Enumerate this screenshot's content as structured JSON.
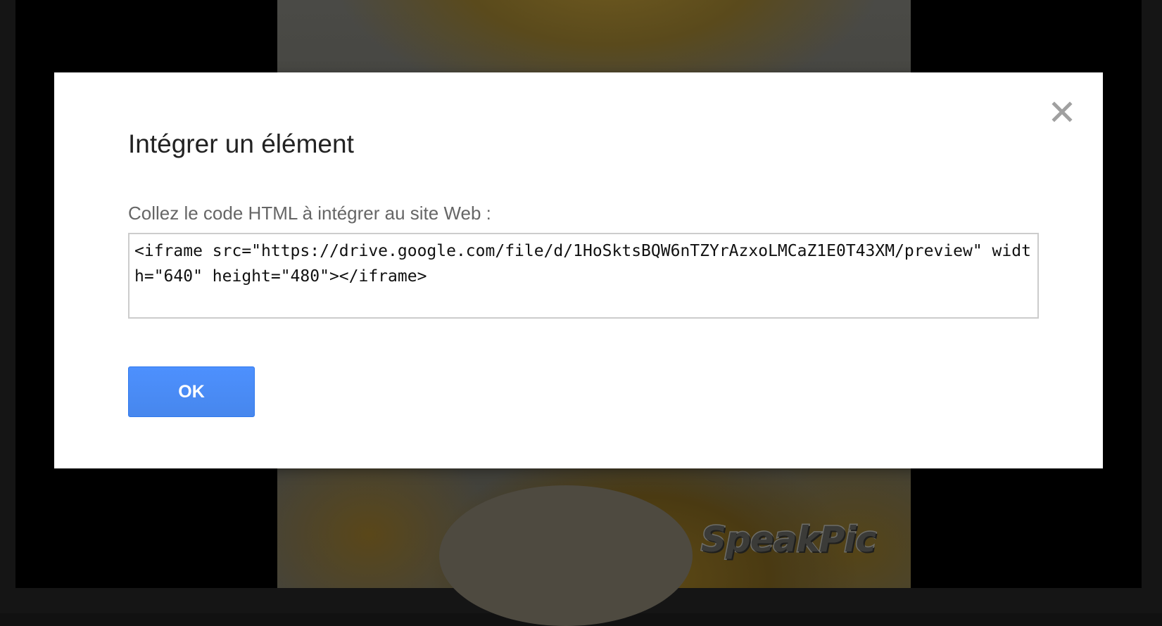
{
  "background": {
    "watermark_text": "SpeakPic"
  },
  "dialog": {
    "title": "Intégrer un élément",
    "close_icon": "close-icon",
    "label": "Collez le code HTML à intégrer au site Web :",
    "embed_code": "<iframe src=\"https://drive.google.com/file/d/1HoSktsBQW6nTZYrAzxoLMCaZ1E0T43XM/preview\" width=\"640\" height=\"480\"></iframe>",
    "ok_label": "OK"
  },
  "colors": {
    "accent": "#4d90fe",
    "backdrop": "#000000",
    "dialog_bg": "#ffffff"
  }
}
